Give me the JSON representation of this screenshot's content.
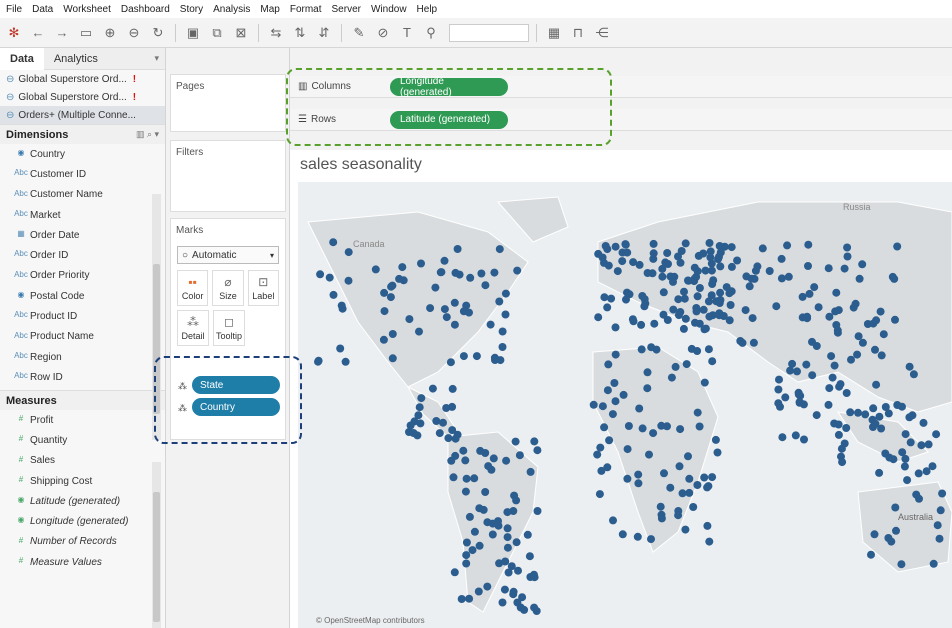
{
  "menu": [
    "File",
    "Data",
    "Worksheet",
    "Dashboard",
    "Story",
    "Analysis",
    "Map",
    "Format",
    "Server",
    "Window",
    "Help"
  ],
  "toolbar_icons": [
    "tableau-logo-icon",
    "undo-icon",
    "redo-icon",
    "save-icon",
    "new-datasource-icon",
    "datasource-icon",
    "refresh-icon",
    "new-worksheet-icon",
    "duplicate-icon",
    "clear-icon",
    "swap-icon",
    "sort-asc-icon",
    "sort-desc-icon",
    "highlight-icon",
    "group-icon",
    "label-icon",
    "pin-icon",
    "fit-icon",
    "presentation-icon",
    "share-icon"
  ],
  "datapane": {
    "tabs": [
      "Data",
      "Analytics"
    ],
    "sources": [
      {
        "label": "Global Superstore Ord...",
        "warn": "!"
      },
      {
        "label": "Global Superstore Ord...",
        "warn": "!"
      },
      {
        "label": "Orders+ (Multiple Conne...",
        "warn": ""
      }
    ],
    "dimensions_title": "Dimensions",
    "dimensions": [
      {
        "label": "Country",
        "icon": "globe-icon"
      },
      {
        "label": "Customer ID",
        "icon": "abc-icon"
      },
      {
        "label": "Customer Name",
        "icon": "abc-icon"
      },
      {
        "label": "Market",
        "icon": "abc-icon"
      },
      {
        "label": "Order Date",
        "icon": "calendar-icon"
      },
      {
        "label": "Order ID",
        "icon": "abc-icon"
      },
      {
        "label": "Order Priority",
        "icon": "abc-icon"
      },
      {
        "label": "Postal Code",
        "icon": "globe-icon"
      },
      {
        "label": "Product ID",
        "icon": "abc-icon"
      },
      {
        "label": "Product Name",
        "icon": "abc-icon"
      },
      {
        "label": "Region",
        "icon": "abc-icon"
      },
      {
        "label": "Row ID",
        "icon": "abc-icon"
      }
    ],
    "measures_title": "Measures",
    "measures": [
      {
        "label": "Profit",
        "icon": "measure-icon",
        "italic": false
      },
      {
        "label": "Quantity",
        "icon": "measure-icon",
        "italic": false
      },
      {
        "label": "Sales",
        "icon": "measure-icon",
        "italic": false
      },
      {
        "label": "Shipping Cost",
        "icon": "measure-icon",
        "italic": false
      },
      {
        "label": "Latitude (generated)",
        "icon": "globe-icon",
        "italic": true
      },
      {
        "label": "Longitude (generated)",
        "icon": "globe-icon",
        "italic": true
      },
      {
        "label": "Number of Records",
        "icon": "measure-icon",
        "italic": true
      },
      {
        "label": "Measure Values",
        "icon": "measure-icon",
        "italic": true
      }
    ]
  },
  "cards": {
    "pages": "Pages",
    "filters": "Filters",
    "marks": "Marks",
    "mark_type": "Automatic",
    "buttons": [
      {
        "label": "Color",
        "icon": "color-icon"
      },
      {
        "label": "Size",
        "icon": "size-icon"
      },
      {
        "label": "Label",
        "icon": "label-icon"
      },
      {
        "label": "Detail",
        "icon": "detail-icon"
      },
      {
        "label": "Tooltip",
        "icon": "tooltip-icon"
      }
    ],
    "detail_pills": [
      "State",
      "Country"
    ]
  },
  "shelves": {
    "columns_label": "Columns",
    "columns_pill": "Longitude (generated)",
    "rows_label": "Rows",
    "rows_pill": "Latitude (generated)"
  },
  "viz": {
    "title": "sales seasonality",
    "map_labels": [
      "Canada",
      "Russia",
      "Australia"
    ],
    "attribution": "© OpenStreetMap contributors"
  },
  "colors": {
    "dot": "#2c5d8f",
    "land": "#d9dcde",
    "water": "#eceff1",
    "pill_green": "#2e9a53",
    "pill_teal": "#1f7ea8",
    "highlight_green": "#5aa02c",
    "highlight_blue": "#1c3f7a"
  }
}
